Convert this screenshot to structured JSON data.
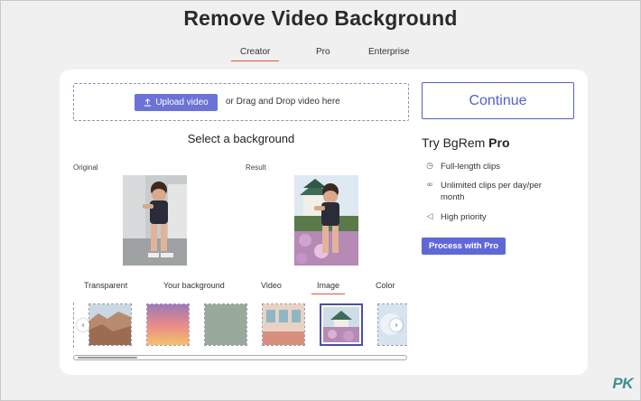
{
  "page": {
    "title": "Remove Video Background"
  },
  "plan_tabs": [
    {
      "label": "Creator",
      "active": true
    },
    {
      "label": "Pro",
      "active": false
    },
    {
      "label": "Enterprise",
      "active": false
    }
  ],
  "upload": {
    "button_label": "Upload video",
    "drag_text": "or Drag and Drop video here",
    "icon": "upload-arrow-icon"
  },
  "select_background": {
    "heading": "Select a background"
  },
  "preview": {
    "original_label": "Original",
    "result_label": "Result"
  },
  "background_tabs": [
    {
      "label": "Transparent",
      "active": false
    },
    {
      "label": "Your background",
      "active": false
    },
    {
      "label": "Video",
      "active": false
    },
    {
      "label": "Image",
      "active": true
    },
    {
      "label": "Color",
      "active": false
    }
  ],
  "background_thumbnails": [
    {
      "name": "canyon",
      "selected": false
    },
    {
      "name": "sunset-gradient",
      "selected": false
    },
    {
      "name": "sage-green",
      "selected": false
    },
    {
      "name": "pastel-building",
      "selected": false
    },
    {
      "name": "castle-garden",
      "selected": true
    },
    {
      "name": "blurred-light",
      "selected": false
    }
  ],
  "carousel": {
    "prev_icon": "chevron-left-icon",
    "next_icon": "chevron-right-icon"
  },
  "side_panel": {
    "continue_label": "Continue",
    "try_prefix": "Try BgRem",
    "try_pro": "Pro",
    "features": [
      {
        "icon": "clock-icon",
        "text": "Full-length clips"
      },
      {
        "icon": "infinity-icon",
        "text": "Unlimited clips per day/per month"
      },
      {
        "icon": "megaphone-icon",
        "text": "High priority"
      }
    ],
    "process_label": "Process with Pro"
  },
  "watermark": {
    "text": "PK",
    "sub": ""
  },
  "colors": {
    "accent": "#6068d8",
    "tab_underline": "#e0533a",
    "card": "#ffffff",
    "page_bg": "#f0f0f0"
  }
}
